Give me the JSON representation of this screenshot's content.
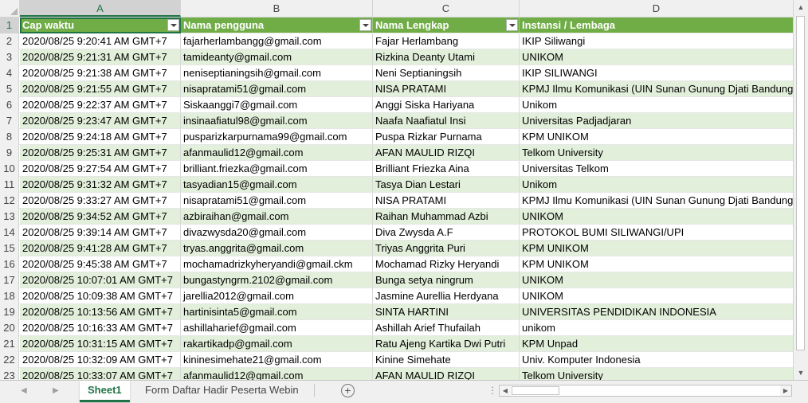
{
  "columns": [
    "A",
    "B",
    "C",
    "D"
  ],
  "headers": [
    "Cap waktu",
    "Nama pengguna",
    "Nama Lengkap",
    "Instansi / Lembaga"
  ],
  "rows": [
    [
      "2020/08/25 9:20:41 AM GMT+7",
      "fajarherlambangg@gmail.com",
      "Fajar Herlambang",
      "IKIP Siliwangi"
    ],
    [
      "2020/08/25 9:21:31 AM GMT+7",
      "tamideanty@gmail.com",
      "Rizkina Deanty Utami",
      "UNIKOM"
    ],
    [
      "2020/08/25 9:21:38 AM GMT+7",
      "neniseptianingsih@gmail.com",
      "Neni Septianingsih",
      "IKIP SILIWANGI"
    ],
    [
      "2020/08/25 9:21:55 AM GMT+7",
      "nisapratami51@gmail.com",
      "NISA PRATAMI",
      "KPMJ Ilmu Komunikasi (UIN Sunan Gunung Djati Bandung)"
    ],
    [
      "2020/08/25 9:22:37 AM GMT+7",
      "Siskaanggi7@gmail.com",
      "Anggi Siska Hariyana",
      "Unikom"
    ],
    [
      "2020/08/25 9:23:47 AM GMT+7",
      "insinaafiatul98@gmail.com",
      "Naafa Naafiatul Insi",
      "Universitas Padjadjaran"
    ],
    [
      "2020/08/25 9:24:18 AM GMT+7",
      "pusparizkarpurnama99@gmail.com",
      "Puspa Rizkar Purnama",
      "KPM UNIKOM"
    ],
    [
      "2020/08/25 9:25:31 AM GMT+7",
      "afanmaulid12@gmail.com",
      "AFAN MAULID RIZQI",
      "Telkom University"
    ],
    [
      "2020/08/25 9:27:54 AM GMT+7",
      "brilliant.friezka@gmail.com",
      "Brilliant Friezka Aina",
      "Universitas Telkom"
    ],
    [
      "2020/08/25 9:31:32 AM GMT+7",
      "tasyadian15@gmail.com",
      "Tasya Dian Lestari",
      "Unikom"
    ],
    [
      "2020/08/25 9:33:27 AM GMT+7",
      "nisapratami51@gmail.com",
      "NISA PRATAMI",
      "KPMJ Ilmu Komunikasi (UIN Sunan Gunung Djati Bandung)"
    ],
    [
      "2020/08/25 9:34:52 AM GMT+7",
      "azbiraihan@gmail.com",
      "Raihan Muhammad Azbi",
      "UNIKOM"
    ],
    [
      "2020/08/25 9:39:14 AM GMT+7",
      "divazwysda20@gmail.com",
      "Diva Zwysda A.F",
      "PROTOKOL BUMI SILIWANGI/UPI"
    ],
    [
      "2020/08/25 9:41:28 AM GMT+7",
      "tryas.anggrita@gmail.com",
      "Triyas Anggrita Puri",
      "KPM UNIKOM"
    ],
    [
      "2020/08/25 9:45:38 AM GMT+7",
      "mochamadrizkyheryandi@gmail.ckm",
      "Mochamad Rizky Heryandi",
      "KPM UNIKOM"
    ],
    [
      "2020/08/25 10:07:01 AM GMT+7",
      "bungastyngrm.2102@gmail.com",
      "Bunga setya ningrum",
      "UNIKOM"
    ],
    [
      "2020/08/25 10:09:38 AM GMT+7",
      "jarellia2012@gmail.com",
      "Jasmine Aurellia Herdyana",
      "UNIKOM"
    ],
    [
      "2020/08/25 10:13:56 AM GMT+7",
      "hartinisinta5@gmail.com",
      "SINTA HARTINI",
      "UNIVERSITAS PENDIDIKAN INDONESIA"
    ],
    [
      "2020/08/25 10:16:33 AM GMT+7",
      "ashillaharief@gmail.com",
      "Ashillah Arief Thufailah",
      "unikom"
    ],
    [
      "2020/08/25 10:31:15 AM GMT+7",
      "rakartikadp@gmail.com",
      "Ratu Ajeng Kartika Dwi Putri",
      "KPM Unpad"
    ],
    [
      "2020/08/25 10:32:09 AM GMT+7",
      "kininesimehate21@gmail.com",
      "Kinine Simehate",
      "Univ. Komputer Indonesia"
    ],
    [
      "2020/08/25 10:33:07 AM GMT+7",
      "afanmaulid12@gmail.com",
      "AFAN MAULID RIZQI",
      "Telkom University"
    ]
  ],
  "sheets": [
    "Sheet1",
    "Form Daftar Hadir Peserta Webin"
  ],
  "colors": {
    "header_green": "#70ad47",
    "band_green": "#e2efda",
    "accent": "#217346"
  }
}
